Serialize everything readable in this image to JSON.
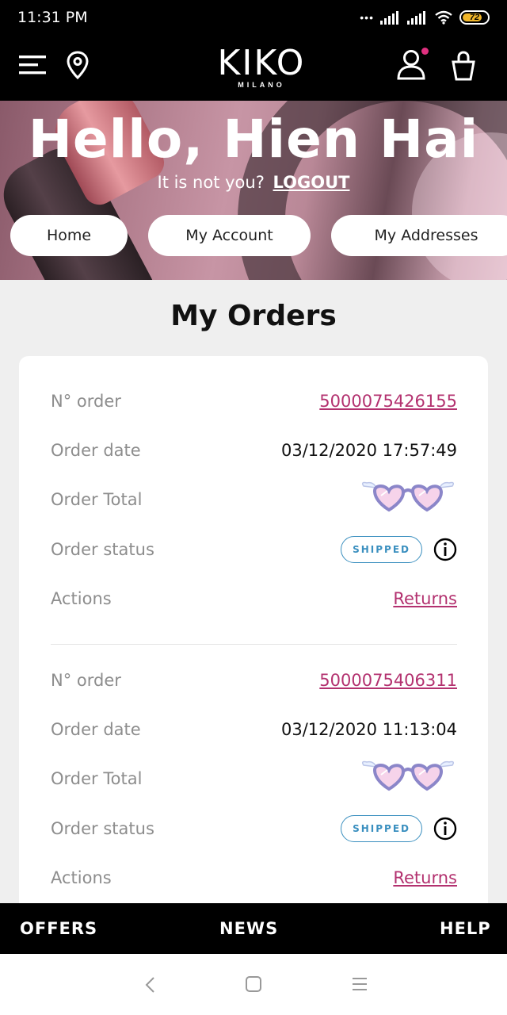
{
  "status_bar": {
    "time": "11:31 PM",
    "battery": "72"
  },
  "header": {
    "logo_text": "KIKO",
    "logo_sub": "MILANO",
    "icons": [
      "menu-icon",
      "location-pin-icon",
      "user-icon",
      "shopping-bag-icon"
    ]
  },
  "hero": {
    "greeting": "Hello, Hien Hai",
    "not_you_text": "It is not you?",
    "logout_label": "LOGOUT",
    "nav": [
      "Home",
      "My Account",
      "My Addresses"
    ]
  },
  "page_title": "My Orders",
  "labels": {
    "order_no": "N° order",
    "order_date": "Order date",
    "order_total": "Order Total",
    "order_status": "Order status",
    "actions": "Actions"
  },
  "orders": [
    {
      "number": "5000075426155",
      "date": "03/12/2020 17:57:49",
      "status": "SHIPPED",
      "action": "Returns"
    },
    {
      "number": "5000075406311",
      "date": "03/12/2020 11:13:04",
      "status": "SHIPPED",
      "action": "Returns"
    }
  ],
  "footer": {
    "offers": "OFFERS",
    "news": "NEWS",
    "help": "HELP"
  },
  "colors": {
    "accent": "#b3316f",
    "status": "#3a8fbf",
    "dot": "#e0307f"
  }
}
